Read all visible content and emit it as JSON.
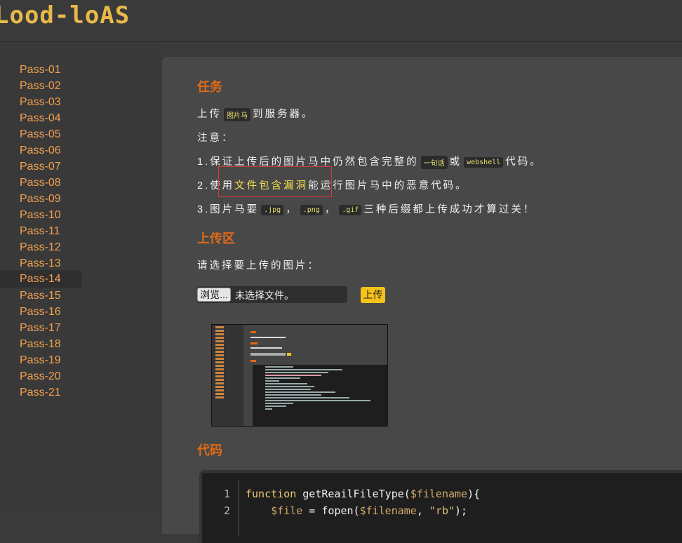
{
  "header": {
    "logo": "Lood-loAS"
  },
  "sidebar": {
    "items": [
      "Pass-01",
      "Pass-02",
      "Pass-03",
      "Pass-04",
      "Pass-05",
      "Pass-06",
      "Pass-07",
      "Pass-08",
      "Pass-09",
      "Pass-10",
      "Pass-11",
      "Pass-12",
      "Pass-13",
      "Pass-14",
      "Pass-15",
      "Pass-16",
      "Pass-17",
      "Pass-18",
      "Pass-19",
      "Pass-20",
      "Pass-21"
    ],
    "active": "Pass-14"
  },
  "task": {
    "title": "任务",
    "line1_pre": "上传",
    "line1_code": "图片马",
    "line1_post": "到服务器。",
    "note": "注意：",
    "line3_pre": "1.保证上传后的图片马中仍然包含完整的",
    "line3_code1": "一句话",
    "line3_mid": "或",
    "line3_code2": "webshell",
    "line3_post": "代码。",
    "line4_pre": "2.使用",
    "line4_hl": "文件包含漏洞",
    "line4_post": "能运行图片马中的恶意代码。",
    "line5_pre": "3.图片马要",
    "ext1": ".jpg",
    "ext2": ".png",
    "ext3": ".gif",
    "sep": "，",
    "line5_post": "三种后缀都上传成功才算过关！"
  },
  "upload": {
    "title": "上传区",
    "prompt": "请选择要上传的图片：",
    "browse_label": "浏览...",
    "file_status": "未选择文件。",
    "submit_label": "上传"
  },
  "code": {
    "title": "代码",
    "lines": [
      {
        "num": "1",
        "kw": "function",
        "rest": " getReailFileType(",
        "var": "$filename",
        "end": "){"
      },
      {
        "num": "2",
        "var1": "$file",
        "mid": " = fopen(",
        "var2": "$filename",
        "sep": ", ",
        "str": "\"rb\"",
        "end": ");"
      }
    ]
  },
  "colors": {
    "accent": "#e06a17",
    "nav": "#f0a050",
    "highlight": "#f5e04a",
    "button": "#f6c21a"
  }
}
